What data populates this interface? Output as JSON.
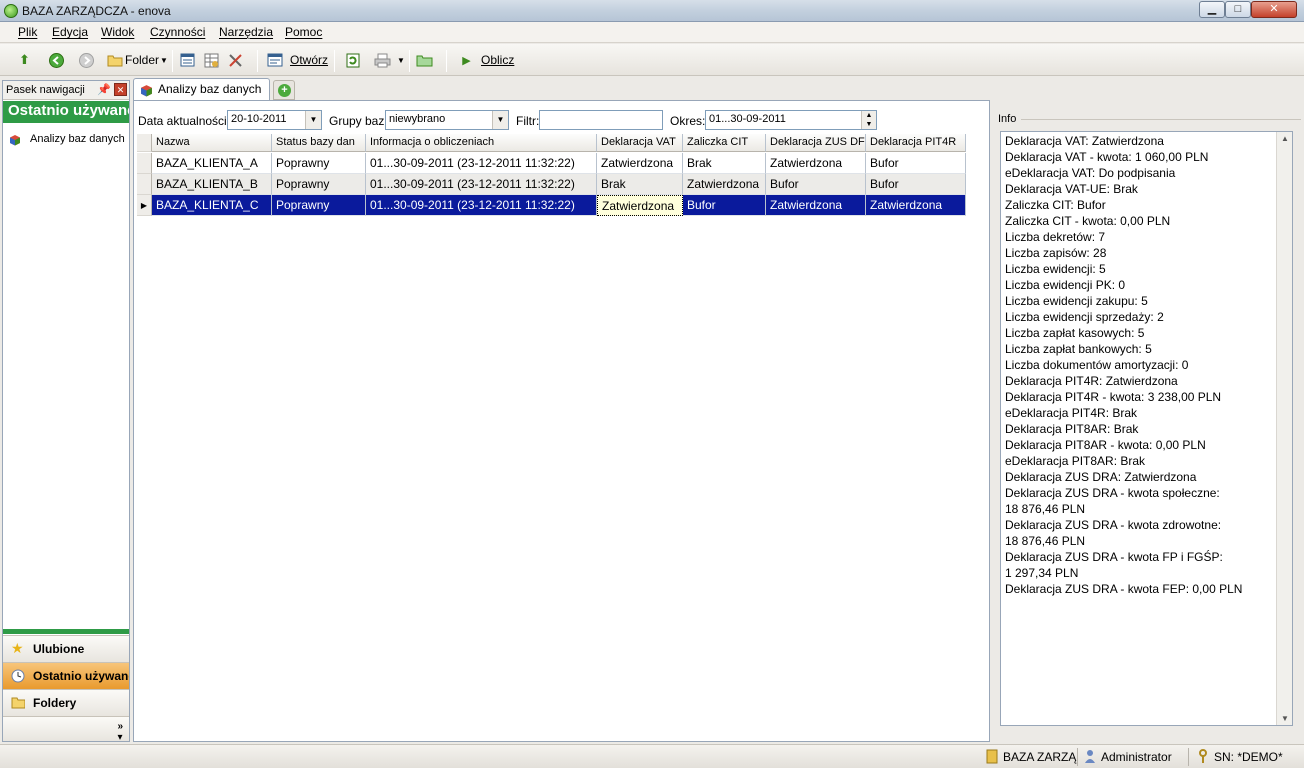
{
  "window": {
    "title": "BAZA ZARZĄDCZA - enova",
    "minimize": "▁",
    "maximize": "□",
    "close": "✕"
  },
  "menu": [
    {
      "label": "Plik"
    },
    {
      "label": "Edycja"
    },
    {
      "label": "Widok"
    },
    {
      "label": "Czynności"
    },
    {
      "label": "Narzędzia"
    },
    {
      "label": "Pomoc"
    }
  ],
  "toolbar": {
    "folder_label": "Folder",
    "otworz_label": "Otwórz",
    "oblicz_label": "Oblicz"
  },
  "nav": {
    "header": "Pasek nawigacji",
    "section_title": "Ostatnio używane",
    "items": [
      {
        "label": "Analizy baz danych"
      }
    ],
    "buttons": [
      {
        "label": "Ulubione"
      },
      {
        "label": "Ostatnio używane"
      },
      {
        "label": "Foldery"
      }
    ]
  },
  "tabs": [
    {
      "label": "Analizy baz danych"
    }
  ],
  "filters": {
    "data_label": "Data aktualności:",
    "data_value": "20-10-2011",
    "grupy_label": "Grupy baz:",
    "grupy_value": "niewybrano",
    "filtr_label": "Filtr:",
    "filtr_value": "",
    "okres_label": "Okres:",
    "okres_value": "01...30-09-2011"
  },
  "grid": {
    "columns": [
      "Nazwa",
      "Status bazy dan",
      "Informacja o obliczeniach",
      "Deklaracja VAT",
      "Zaliczka CIT",
      "Deklaracja ZUS DF",
      "Deklaracja PIT4R"
    ],
    "rows": [
      [
        "BAZA_KLIENTA_A",
        "Poprawny",
        "01...30-09-2011 (23-12-2011 11:32:22)",
        "Zatwierdzona",
        "Brak",
        "Zatwierdzona",
        "Bufor"
      ],
      [
        "BAZA_KLIENTA_B",
        "Poprawny",
        "01...30-09-2011 (23-12-2011 11:32:22)",
        "Brak",
        "Zatwierdzona",
        "Bufor",
        "Bufor"
      ],
      [
        "BAZA_KLIENTA_C",
        "Poprawny",
        "01...30-09-2011 (23-12-2011 11:32:22)",
        "Zatwierdzona",
        "Bufor",
        "Zatwierdzona",
        "Zatwierdzona"
      ]
    ],
    "selected_row": 2
  },
  "info": {
    "label": "Info",
    "lines": [
      "Deklaracja VAT: Zatwierdzona",
      "Deklaracja VAT - kwota: 1 060,00 PLN",
      "eDeklaracja VAT: Do podpisania",
      "Deklaracja VAT-UE: Brak",
      "Zaliczka CIT: Bufor",
      "Zaliczka CIT - kwota: 0,00 PLN",
      "Liczba dekretów: 7",
      "Liczba zapisów: 28",
      "Liczba ewidencji: 5",
      "Liczba ewidencji PK: 0",
      "Liczba ewidencji zakupu: 5",
      "Liczba ewidencji sprzedaży: 2",
      "Liczba zapłat kasowych: 5",
      "Liczba zapłat bankowych: 5",
      "Liczba dokumentów amortyzacji: 0",
      "Deklaracja PIT4R: Zatwierdzona",
      "Deklaracja PIT4R - kwota: 3 238,00 PLN",
      "eDeklaracja PIT4R: Brak",
      "Deklaracja PIT8AR: Brak",
      "Deklaracja PIT8AR - kwota: 0,00 PLN",
      "eDeklaracja PIT8AR: Brak",
      "Deklaracja ZUS DRA: Zatwierdzona",
      "Deklaracja ZUS DRA - kwota społeczne:",
      "18 876,46 PLN",
      "Deklaracja ZUS DRA - kwota zdrowotne:",
      "18 876,46 PLN",
      "Deklaracja ZUS DRA - kwota FP i FGŚP:",
      "1 297,34 PLN",
      "Deklaracja ZUS DRA - kwota FEP: 0,00 PLN"
    ]
  },
  "status": {
    "database": "BAZA ZARZĄ",
    "user": "Administrator",
    "serial": "SN: *DEMO*"
  }
}
